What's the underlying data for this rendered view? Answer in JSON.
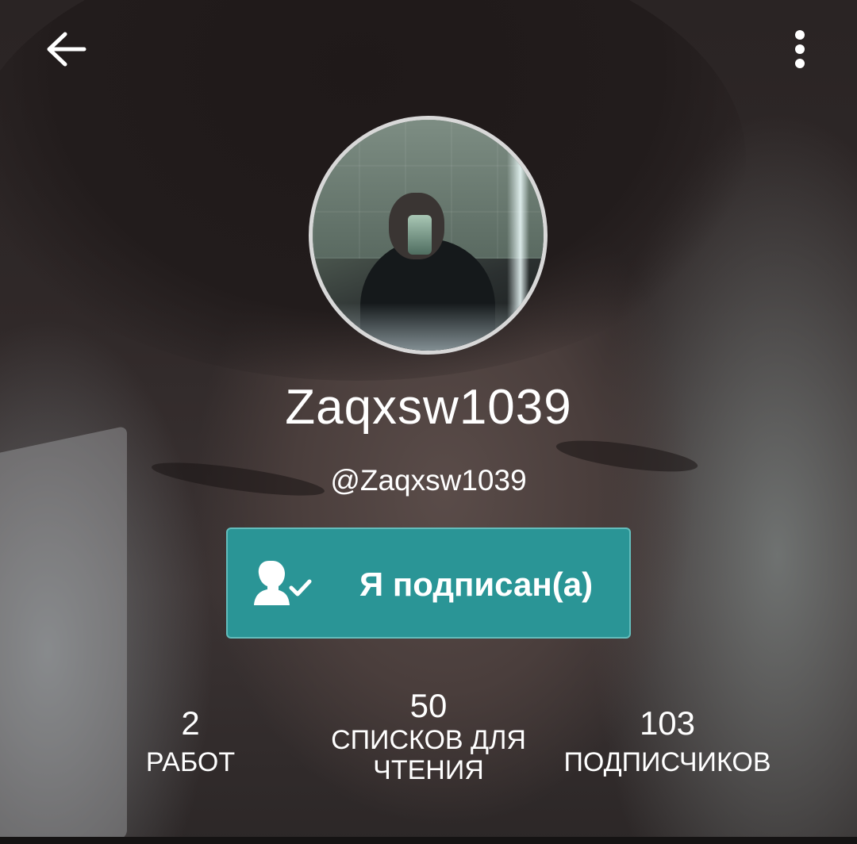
{
  "profile": {
    "display_name": "Zaqxsw1039",
    "username": "@Zaqxsw1039"
  },
  "follow_button": {
    "label": "Я подписан(а)",
    "icon": "user-check-icon"
  },
  "stats": [
    {
      "value": "2",
      "label": "РАБОТ"
    },
    {
      "value": "50",
      "label": "СПИСКОВ ДЛЯ ЧТЕНИЯ"
    },
    {
      "value": "103",
      "label": "ПОДПИСЧИКОВ"
    }
  ],
  "toolbar": {
    "back_icon": "arrow-left-icon",
    "more_icon": "more-vert-icon"
  },
  "colors": {
    "accent": "#2a9596",
    "accent_border": "#63bdbc",
    "text": "#ffffff"
  }
}
